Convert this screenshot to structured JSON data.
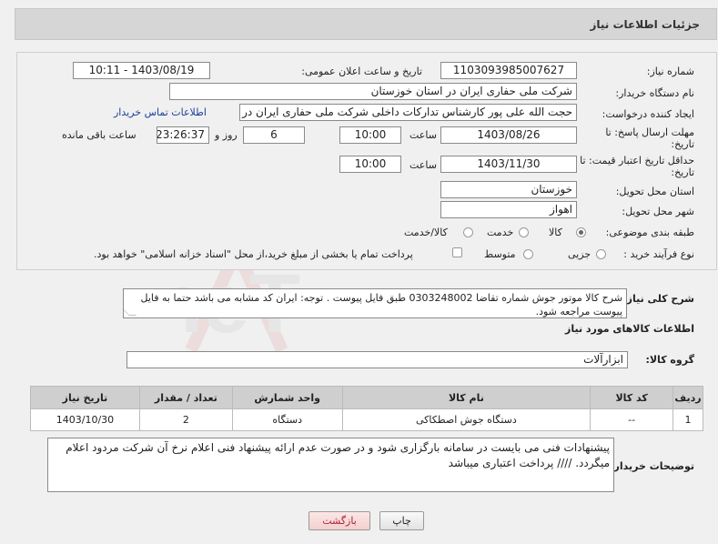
{
  "header": {
    "title": "جزئیات اطلاعات نیاز"
  },
  "form": {
    "need_number": {
      "label": "شماره نیاز:",
      "value": "1103093985007627"
    },
    "announce_datetime": {
      "label": "تاریخ و ساعت اعلان عمومی:",
      "value": "1403/08/19 - 10:11"
    },
    "buyer_org": {
      "label": "نام دستگاه خریدار:",
      "value": "شرکت ملی حفاری ایران در استان خوزستان"
    },
    "requester": {
      "label": "ایجاد کننده درخواست:",
      "value": "حجت الله علی پور کارشناس تدارکات داخلی شرکت ملی حفاری ایران در استان",
      "contact_link": "اطلاعات تماس خریدار"
    },
    "reply_deadline": {
      "label1": "مهلت ارسال پاسخ: تا",
      "label2": "تاریخ:",
      "date": "1403/08/26",
      "time_label": "ساعت",
      "time": "10:00",
      "days": "6",
      "days_label": "روز و",
      "remaining": "23:26:37",
      "remaining_label": "ساعت باقی مانده"
    },
    "price_validity": {
      "label1": "حداقل تاریخ اعتبار قیمت: تا",
      "label2": "تاریخ:",
      "date": "1403/11/30",
      "time_label": "ساعت",
      "time": "10:00"
    },
    "province": {
      "label": "استان محل تحویل:",
      "value": "خوزستان"
    },
    "city": {
      "label": "شهر محل تحویل:",
      "value": "اهواز"
    },
    "category": {
      "label": "طبقه بندی موضوعی:",
      "options": [
        "کالا",
        "خدمت",
        "کالا/خدمت"
      ],
      "selected": "کالا"
    },
    "purchase_type": {
      "label": "نوع فرآیند خرید :",
      "options": [
        "جزیی",
        "متوسط"
      ],
      "checkbox_text": "پرداخت تمام یا بخشی از مبلغ خرید،از محل \"اسناد خزانه اسلامی\" خواهد بود."
    }
  },
  "description": {
    "label": "شرح کلی نیاز:",
    "value": "شرح کالا  موتور جوش شماره تقاضا 0303248002  طبق فایل پیوست . توجه: ایران کد مشابه می باشد حتما به فایل پیوست مراجعه شود."
  },
  "goods_section": {
    "title": "اطلاعات کالاهای مورد نیاز",
    "group_label": "گروه کالا:",
    "group_value": "ابزارآلات"
  },
  "table": {
    "headers": [
      "ردیف",
      "کد کالا",
      "نام کالا",
      "واحد شمارش",
      "تعداد / مقدار",
      "تاریخ نیاز"
    ],
    "rows": [
      [
        "1",
        "--",
        "دستگاه جوش اصطکاکی",
        "دستگاه",
        "2",
        "1403/10/30"
      ]
    ]
  },
  "buyer_notes": {
    "label": "توضیحات خریدار:",
    "value": "پیشنهادات فنی می بایست در سامانه بارگزاری شود و در صورت عدم ارائه پیشنهاد فنی اعلام نرخ آن شرکت مردود اعلام میگردد.  //// پرداخت اعتباری میباشد"
  },
  "buttons": {
    "print": "چاپ",
    "back": "بازگشت"
  },
  "watermark": {
    "text": "AriaTender.neT"
  }
}
